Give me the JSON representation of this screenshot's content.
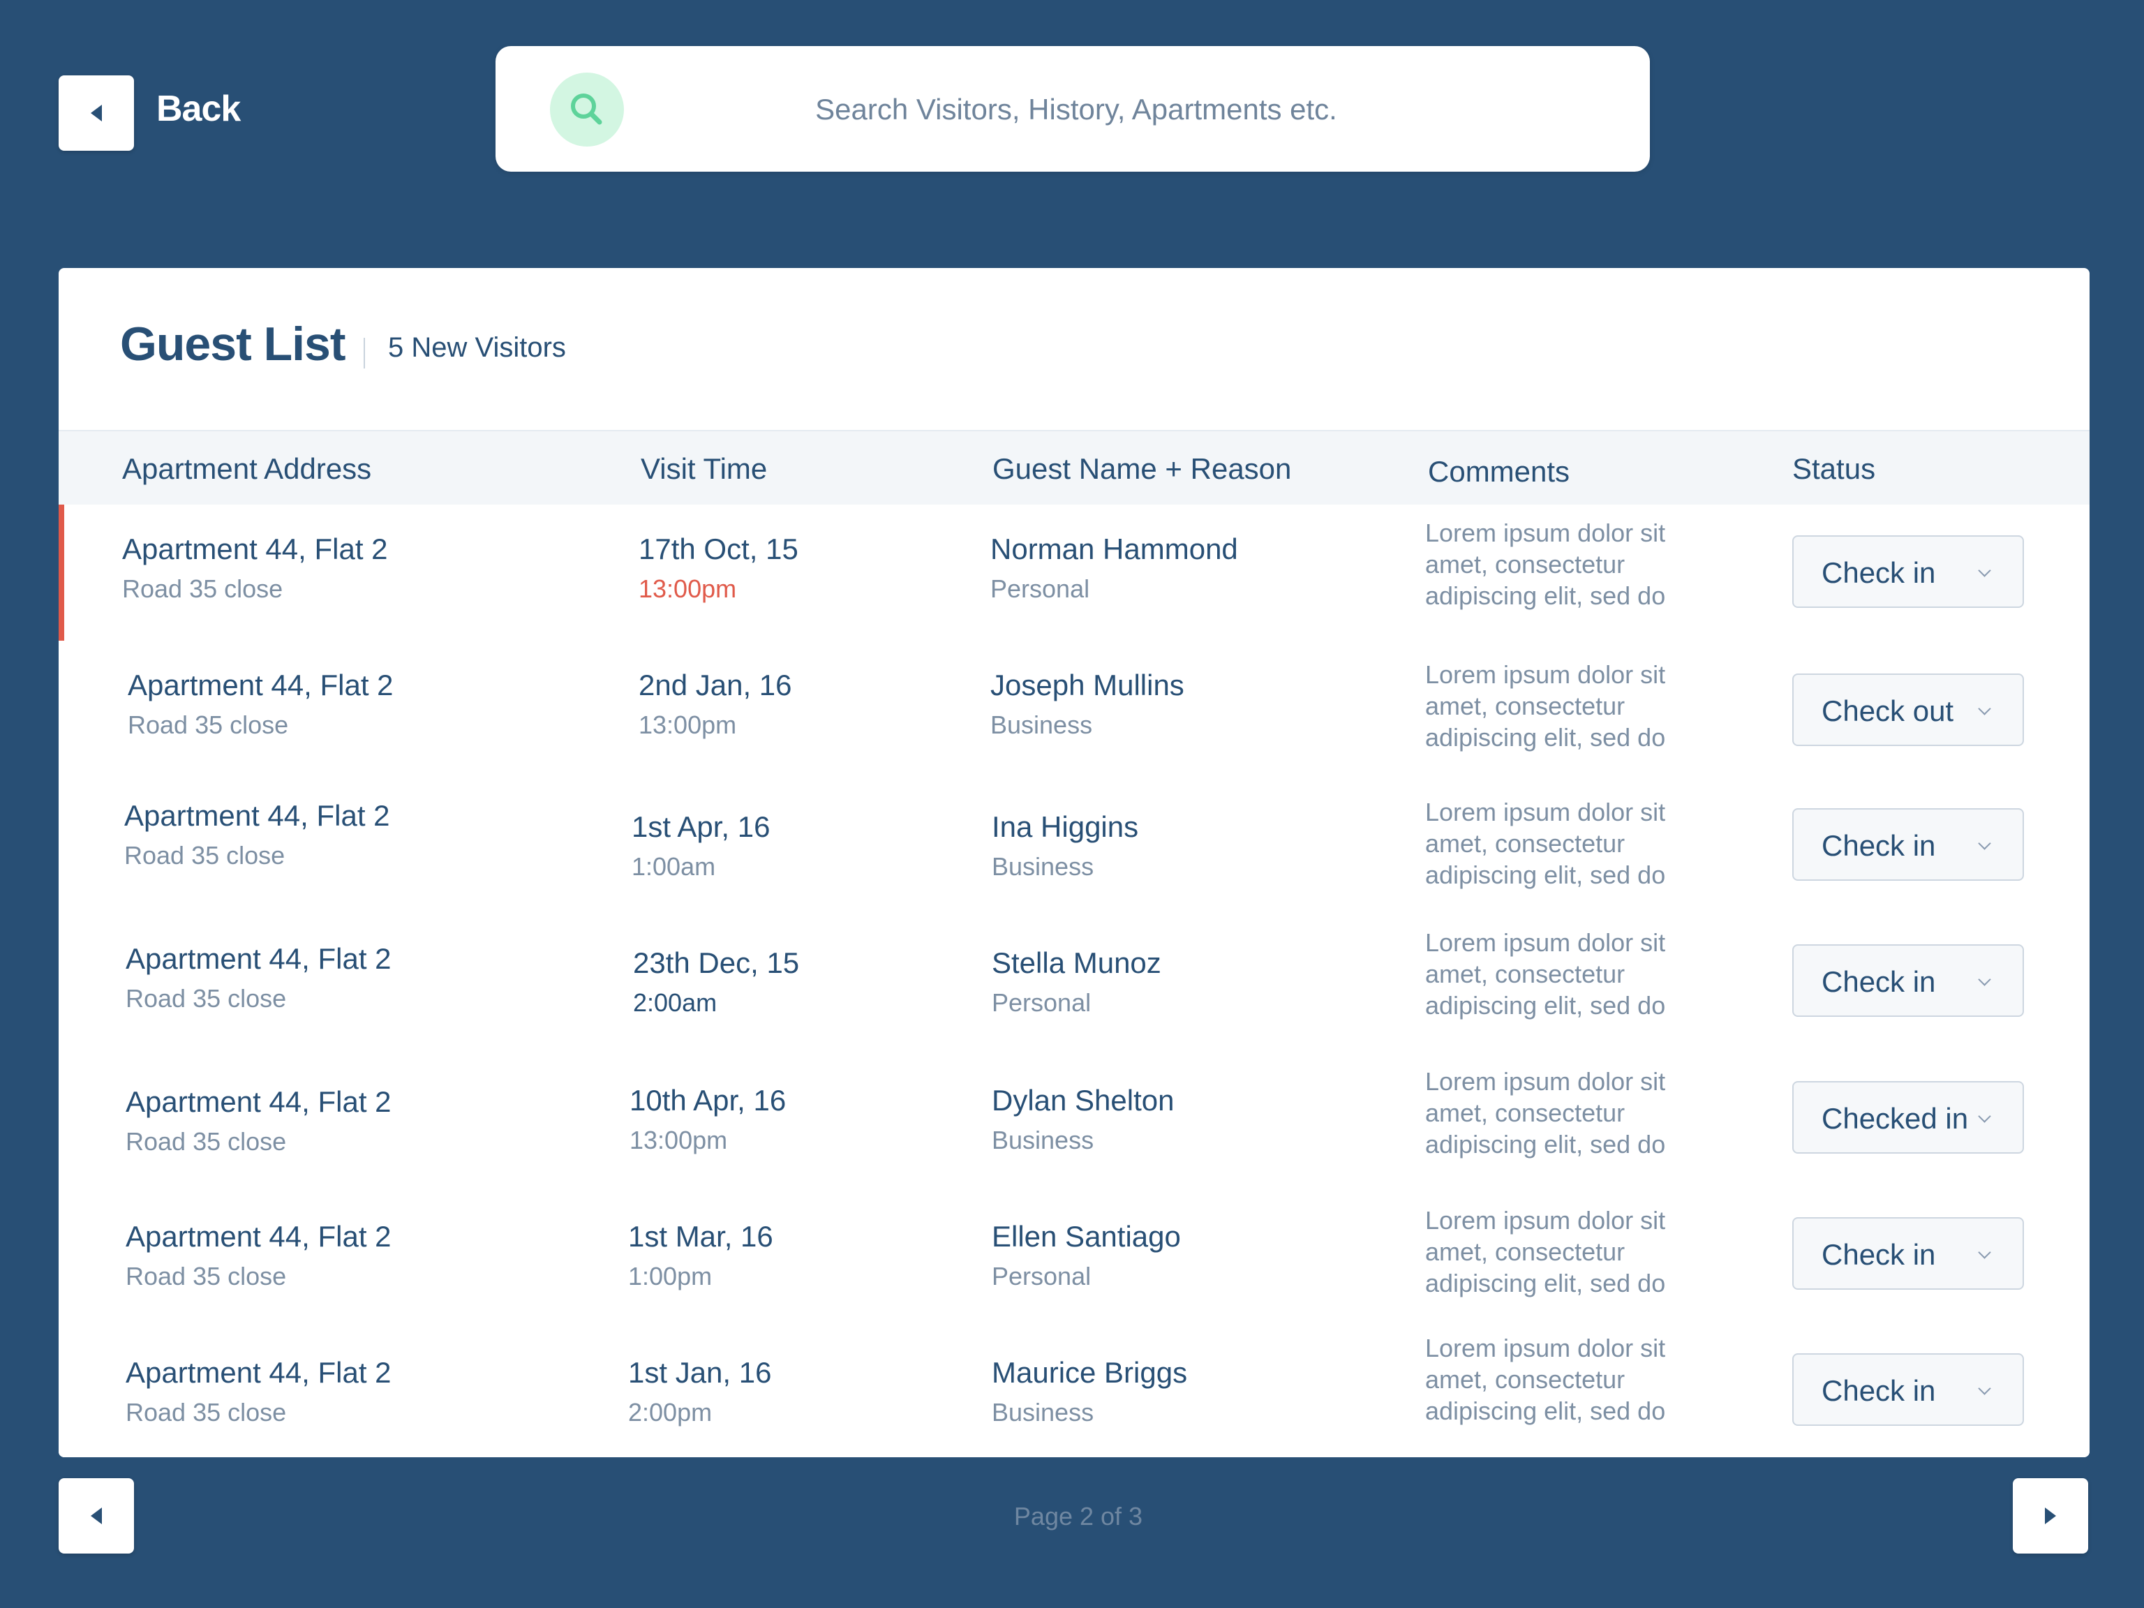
{
  "header": {
    "back_label": "Back",
    "search_placeholder": "Search Visitors, History, Apartments etc."
  },
  "guest_list": {
    "title": "Guest List",
    "new_visitors": "5 New Visitors",
    "columns": [
      "Apartment Address",
      "Visit Time",
      "Guest Name + Reason",
      "Comments",
      "Status"
    ],
    "rows": [
      {
        "address": "Apartment 44, Flat 2",
        "road": "Road 35 close",
        "date": "17th Oct, 15",
        "time": "13:00pm",
        "guest": "Norman Hammond",
        "reason": "Personal",
        "comment": "Lorem ipsum dolor sit amet, consectetur adipiscing elit, sed do",
        "status": "Check in"
      },
      {
        "address": "Apartment 44, Flat 2",
        "road": "Road 35 close",
        "date": "2nd Jan, 16",
        "time": "13:00pm",
        "guest": "Joseph Mullins",
        "reason": "Business",
        "comment": "Lorem ipsum dolor sit amet, consectetur adipiscing elit, sed do",
        "status": "Check out"
      },
      {
        "address": "Apartment 44, Flat 2",
        "road": "Road 35 close",
        "date": "1st Apr, 16",
        "time": "1:00am",
        "guest": "Ina Higgins",
        "reason": "Business",
        "comment": "Lorem ipsum dolor sit amet, consectetur adipiscing elit, sed do",
        "status": "Check in"
      },
      {
        "address": "Apartment 44, Flat 2",
        "road": "Road 35 close",
        "date": "23th Dec, 15",
        "time": "2:00am",
        "guest": "Stella Munoz",
        "reason": "Personal",
        "comment": "Lorem ipsum dolor sit amet, consectetur adipiscing elit, sed do",
        "status": "Check in"
      },
      {
        "address": "Apartment 44, Flat 2",
        "road": "Road 35 close",
        "date": "10th Apr, 16",
        "time": "13:00pm",
        "guest": "Dylan Shelton",
        "reason": "Business",
        "comment": "Lorem ipsum dolor sit amet, consectetur adipiscing elit, sed do",
        "status": "Checked in"
      },
      {
        "address": "Apartment 44, Flat 2",
        "road": "Road 35 close",
        "date": "1st Mar, 16",
        "time": "1:00pm",
        "guest": "Ellen Santiago",
        "reason": "Personal",
        "comment": "Lorem ipsum dolor sit amet, consectetur adipiscing elit, sed do",
        "status": "Check in"
      },
      {
        "address": "Apartment 44, Flat 2",
        "road": "Road 35 close",
        "date": "1st Jan, 16",
        "time": "2:00pm",
        "guest": "Maurice Briggs",
        "reason": "Business",
        "comment": "Lorem ipsum dolor sit amet, consectetur adipiscing elit, sed do",
        "status": "Check in"
      }
    ]
  },
  "pagination": {
    "label": "Page 2 of 3"
  },
  "icons": {
    "back": "back-arrow-icon",
    "search": "search-icon",
    "prev": "prev-arrow-icon",
    "next": "next-arrow-icon",
    "dropdown": "chevron-down-icon"
  },
  "colors": {
    "background": "#284f75",
    "accent_red": "#e05a4a",
    "search_icon_bg": "#d3f6e2",
    "search_icon": "#5ed39a"
  }
}
